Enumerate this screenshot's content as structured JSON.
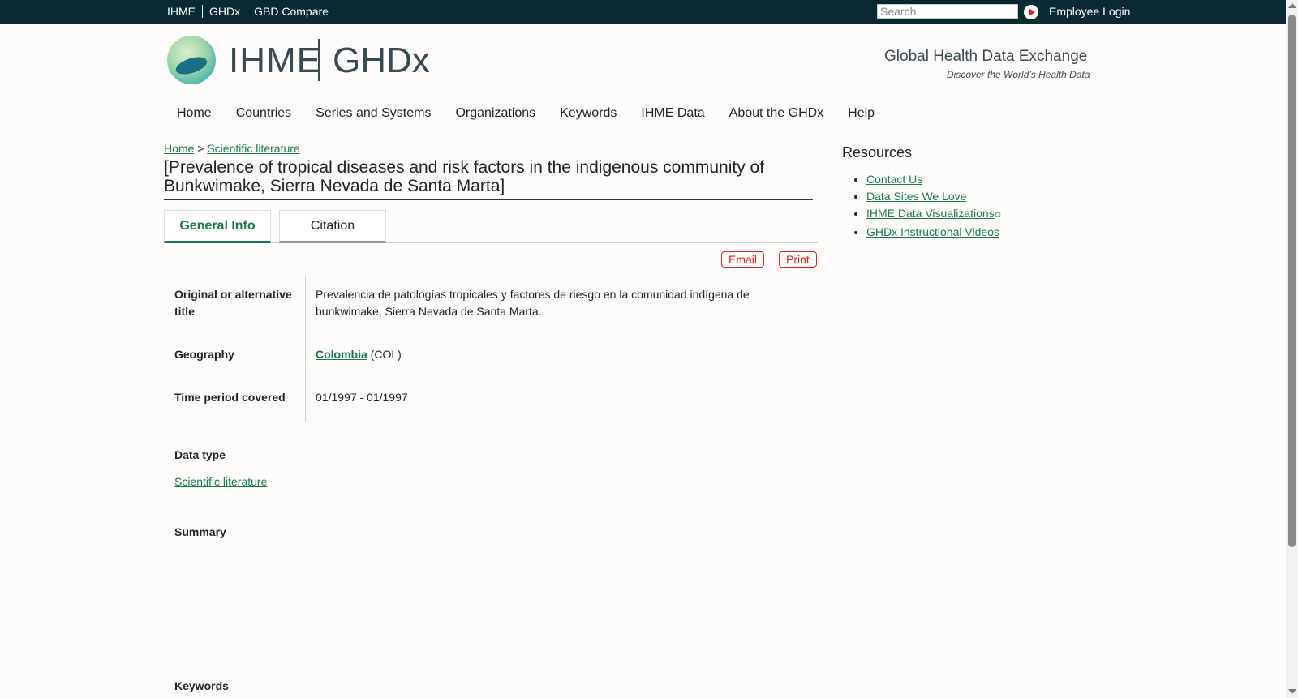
{
  "topbar": {
    "links": [
      "IHME",
      "GHDx",
      "GBD Compare"
    ],
    "search_placeholder": "Search",
    "login": "Employee Login"
  },
  "logo": {
    "ihme": "IHME",
    "ghdx": "GHDx"
  },
  "tagline": {
    "title": "Global Health Data Exchange",
    "sub": "Discover the World’s Health Data"
  },
  "nav": [
    "Home",
    "Countries",
    "Series and Systems",
    "Organizations",
    "Keywords",
    "IHME Data",
    "About the GHDx",
    "Help"
  ],
  "breadcrumb": {
    "home": "Home",
    "sep": ">",
    "current": "Scientific literature"
  },
  "page_title": "[Prevalence of tropical diseases and risk factors in the indigenous community of Bunkwimake, Sierra Nevada de Santa Marta]",
  "tabs": [
    "General Info",
    "Citation"
  ],
  "actions": {
    "email": "Email",
    "print": "Print"
  },
  "fields": {
    "alt_title_label": "Original or alternative title",
    "alt_title_value": "Prevalencia de patologías tropicales y factores de riesgo en la comunidad indígena de bunkwimake, Sierra Nevada de Santa Marta.",
    "geo_label": "Geography",
    "geo_link": "Colombia",
    "geo_code": "(COL)",
    "time_label": "Time period covered",
    "time_value": "01/1997 - 01/1997",
    "datatype_label": "Data type",
    "datatype_value": "Scientific literature",
    "summary_label": "Summary",
    "keywords_label": "Keywords"
  },
  "resources": {
    "heading": "Resources",
    "items": [
      "Contact Us",
      "Data Sites We Love",
      "IHME Data Visualizations",
      "GHDx Instructional Videos"
    ]
  }
}
